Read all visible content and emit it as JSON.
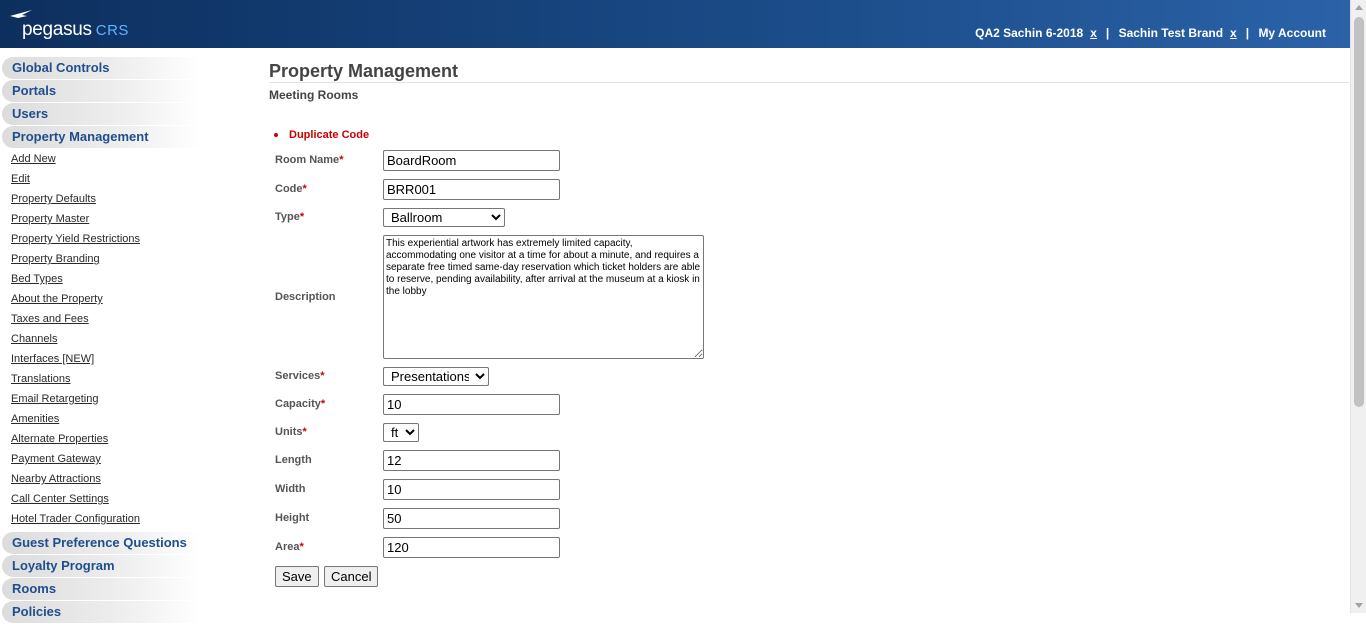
{
  "header": {
    "logo_main": "pegasus",
    "logo_sub": "CRS",
    "context_1": "QA2 Sachin 6-2018",
    "context_2": "Sachin Test Brand",
    "remove_symbol": "x",
    "separator": "|",
    "my_account": "My Account"
  },
  "sidebar": {
    "sections_top": [
      {
        "label": "Global Controls"
      },
      {
        "label": "Portals"
      },
      {
        "label": "Users"
      },
      {
        "label": "Property Management"
      }
    ],
    "sub_items": [
      {
        "label": "Add New"
      },
      {
        "label": "Edit"
      },
      {
        "label": "Property Defaults"
      },
      {
        "label": "Property Master"
      },
      {
        "label": "Property Yield Restrictions"
      },
      {
        "label": "Property Branding"
      },
      {
        "label": "Bed Types"
      },
      {
        "label": "About the Property"
      },
      {
        "label": "Taxes and Fees"
      },
      {
        "label": "Channels"
      },
      {
        "label": "Interfaces [NEW]"
      },
      {
        "label": "Translations"
      },
      {
        "label": "Email Retargeting"
      },
      {
        "label": "Amenities"
      },
      {
        "label": "Alternate Properties"
      },
      {
        "label": "Payment Gateway"
      },
      {
        "label": "Nearby Attractions"
      },
      {
        "label": "Call Center Settings"
      },
      {
        "label": "Hotel Trader Configuration"
      }
    ],
    "sections_bottom": [
      {
        "label": "Guest Preference Questions"
      },
      {
        "label": "Loyalty Program"
      },
      {
        "label": "Rooms"
      },
      {
        "label": "Policies"
      }
    ]
  },
  "main": {
    "page_title": "Property Management",
    "subtitle": "Meeting Rooms",
    "error_message": "Duplicate Code",
    "required_marker": "*",
    "form": {
      "room_name": {
        "label": "Room Name",
        "value": "BoardRoom"
      },
      "code": {
        "label": "Code",
        "value": "BRR001"
      },
      "type": {
        "label": "Type",
        "selected": "Ballroom"
      },
      "description": {
        "label": "Description",
        "value": "This experiential artwork has extremely limited capacity, accommodating one visitor at a time for about a minute, and requires a separate free timed same-day reservation which ticket holders are able to reserve, pending availability, after arrival at the museum at a kiosk in the lobby"
      },
      "services": {
        "label": "Services",
        "selected": "Presentations"
      },
      "capacity": {
        "label": "Capacity",
        "value": "10"
      },
      "units": {
        "label": "Units",
        "selected": "ft"
      },
      "length": {
        "label": "Length",
        "value": "12"
      },
      "width": {
        "label": "Width",
        "value": "10"
      },
      "height": {
        "label": "Height",
        "value": "50"
      },
      "area": {
        "label": "Area",
        "value": "120"
      }
    },
    "buttons": {
      "save": "Save",
      "cancel": "Cancel"
    }
  },
  "colors": {
    "header_dark": "#0d2f5e",
    "header_light": "#2b62a8",
    "nav_text": "#1f4e8c",
    "error": "#cc0000"
  }
}
